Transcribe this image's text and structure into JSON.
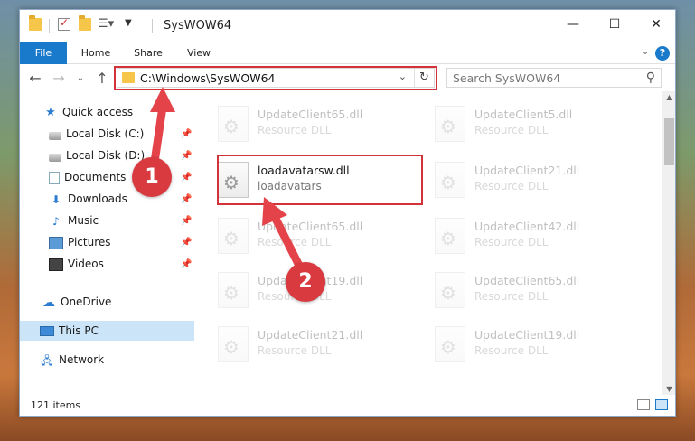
{
  "window": {
    "title": "SysWOW64"
  },
  "ribbon": {
    "tabs": [
      "File",
      "Home",
      "Share",
      "View"
    ],
    "help": "?"
  },
  "nav": {
    "address": "C:\\Windows\\SysWOW64",
    "search_placeholder": "Search SysWOW64"
  },
  "sidebar": {
    "items": [
      {
        "label": "Quick access",
        "icon": "star-icon"
      },
      {
        "label": "Local Disk (C:)",
        "icon": "drive-icon",
        "pinned": true
      },
      {
        "label": "Local Disk (D:)",
        "icon": "drive-icon",
        "pinned": true
      },
      {
        "label": "Documents",
        "icon": "documents-icon",
        "pinned": true
      },
      {
        "label": "Downloads",
        "icon": "download-icon",
        "pinned": true
      },
      {
        "label": "Music",
        "icon": "music-icon",
        "pinned": true
      },
      {
        "label": "Pictures",
        "icon": "pictures-icon",
        "pinned": true
      },
      {
        "label": "Videos",
        "icon": "videos-icon",
        "pinned": true
      },
      {
        "label": "OneDrive",
        "icon": "cloud-icon"
      },
      {
        "label": "This PC",
        "icon": "computer-icon",
        "selected": true
      },
      {
        "label": "Network",
        "icon": "network-icon"
      }
    ]
  },
  "files": [
    {
      "name": "UpdateClient65.dll",
      "type": "Resource DLL",
      "faded": true
    },
    {
      "name": "UpdateClient5.dll",
      "type": "Resource DLL",
      "faded": true
    },
    {
      "name": "loadavatarsw.dll",
      "type": "loadavatars",
      "faded": false
    },
    {
      "name": "UpdateClient21.dll",
      "type": "Resource DLL",
      "faded": true
    },
    {
      "name": "UpdateClient65.dll",
      "type": "Resource DLL",
      "faded": true
    },
    {
      "name": "UpdateClient42.dll",
      "type": "Resource DLL",
      "faded": true
    },
    {
      "name": "UpdateClient19.dll",
      "type": "Resource DLL",
      "faded": true
    },
    {
      "name": "UpdateClient65.dll",
      "type": "Resource DLL",
      "faded": true
    },
    {
      "name": "UpdateClient21.dll",
      "type": "Resource DLL",
      "faded": true
    },
    {
      "name": "UpdateClient19.dll",
      "type": "Resource DLL",
      "faded": true
    }
  ],
  "status": {
    "item_count": "121 items"
  },
  "annotations": {
    "step1": "1",
    "step2": "2"
  },
  "colors": {
    "accent": "#1979ca",
    "highlight": "#d2333a",
    "annotation": "#d93a3f",
    "selection": "#cce4f7"
  }
}
